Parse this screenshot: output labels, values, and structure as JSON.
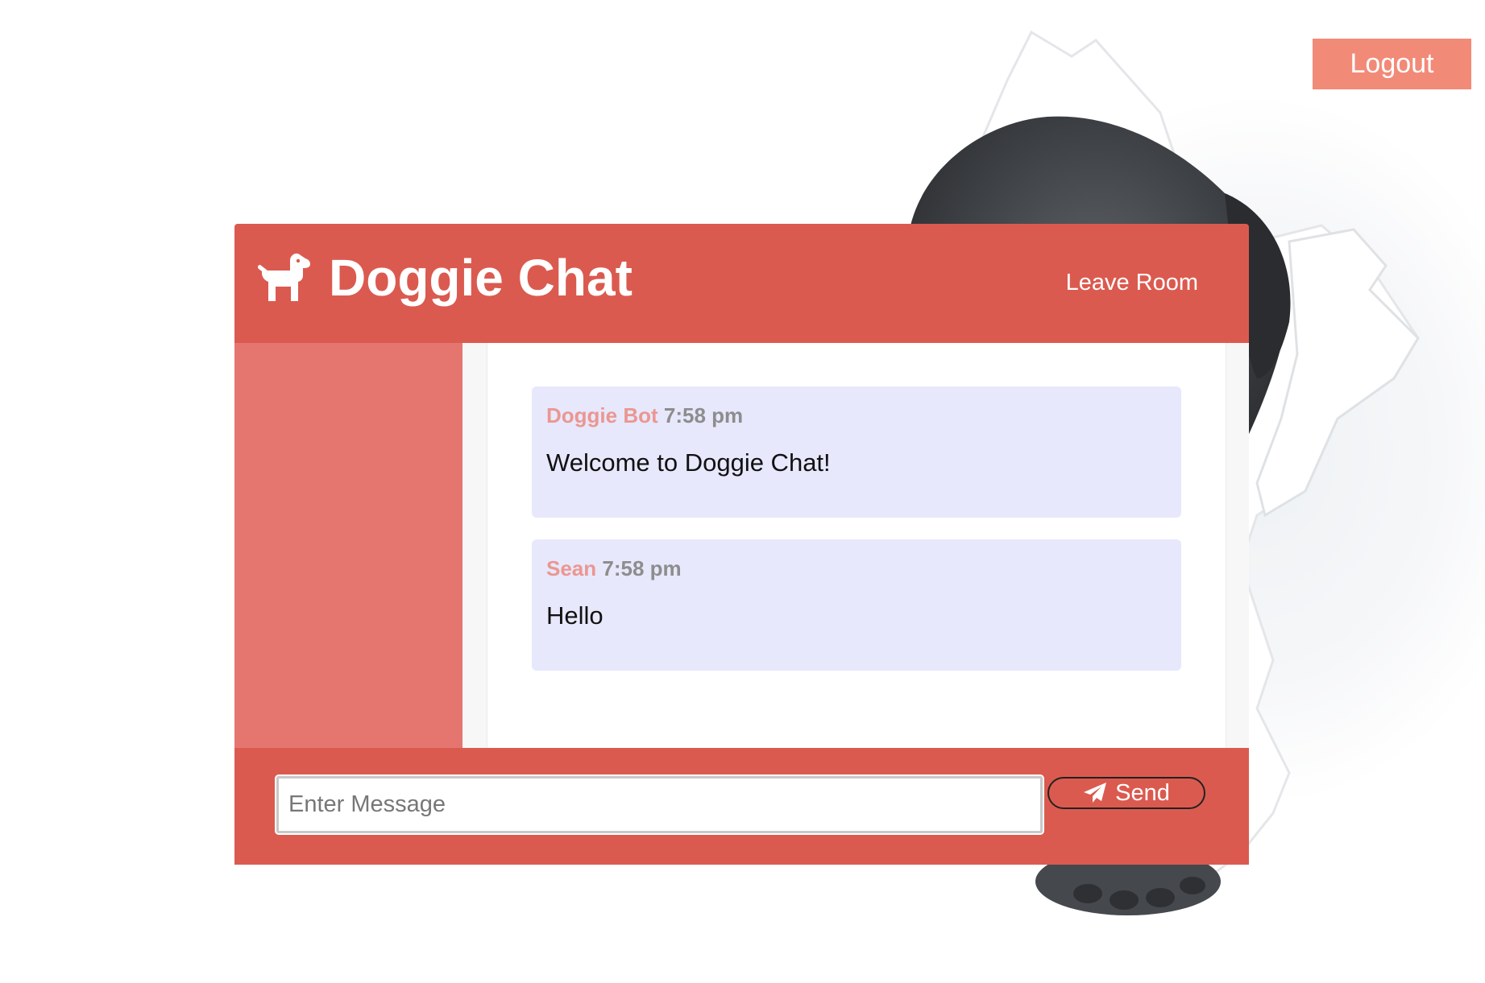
{
  "header": {
    "logout_label": "Logout"
  },
  "chat": {
    "title": "Doggie Chat",
    "logo_icon": "dog-icon",
    "leave_room_label": "Leave Room",
    "messages": [
      {
        "author": "Doggie Bot",
        "time": "7:58 pm",
        "text": "Welcome to Doggie Chat!"
      },
      {
        "author": "Sean",
        "time": "7:58 pm",
        "text": "Hello"
      }
    ]
  },
  "composer": {
    "placeholder": "Enter Message",
    "send_label": "Send",
    "send_icon": "paper-plane-icon"
  },
  "colors": {
    "primary": "#db5a4f",
    "sidebar": "#e5766f",
    "logout": "#f28a78",
    "message_bg": "#e7e8fc",
    "author": "#eb9791"
  }
}
